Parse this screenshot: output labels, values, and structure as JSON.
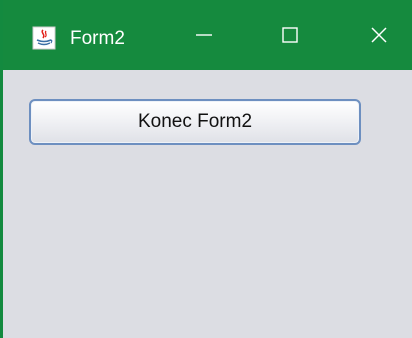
{
  "window": {
    "title": "Form2",
    "title_bar_color": "#158a3e",
    "background_color": "#dcdde3",
    "icons": {
      "app": "java-icon",
      "minimize": "minimize-icon",
      "maximize": "maximize-icon",
      "close": "close-icon"
    }
  },
  "main": {
    "button_label": "Konec Form2"
  }
}
